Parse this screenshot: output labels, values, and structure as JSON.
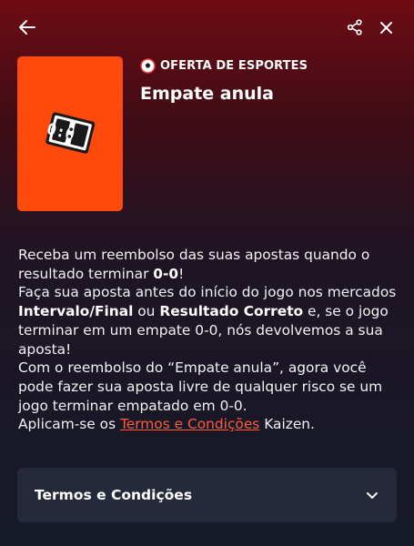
{
  "header": {
    "back_icon": "arrow-left-icon",
    "share_icon": "share-icon",
    "close_icon": "close-icon"
  },
  "promo": {
    "image_icon": "scoreboard-icon",
    "image_text": "0:0",
    "category_icon": "sports-ball-icon",
    "category": "OFERTA DE ESPORTES",
    "title": "Empate anula",
    "accent_color": "#ff4a0d"
  },
  "description": {
    "p1_text": "Receba um reembolso das suas apostas quando o resultado terminar ",
    "p1_bold": "0-0",
    "p1_end": "!",
    "p2_start": "Faça sua aposta antes do início do jogo nos mercados ",
    "p2_bold1": "Intervalo/Final",
    "p2_mid": " ou ",
    "p2_bold2": "Resultado Correto",
    "p2_end": " e, se o jogo terminar em um empate 0-0, nós devolvemos a sua aposta!",
    "p3": "Com o reembolso do “Empate anula”, agora você pode fazer sua aposta livre de qualquer risco se um jogo terminar empatado em 0-0.",
    "p4_start": "Aplicam-se os ",
    "p4_link": "Termos e Condições",
    "p4_end": " Kaizen."
  },
  "accordion": {
    "label": "Termos e Condições",
    "icon": "chevron-down-icon",
    "expanded": false
  }
}
